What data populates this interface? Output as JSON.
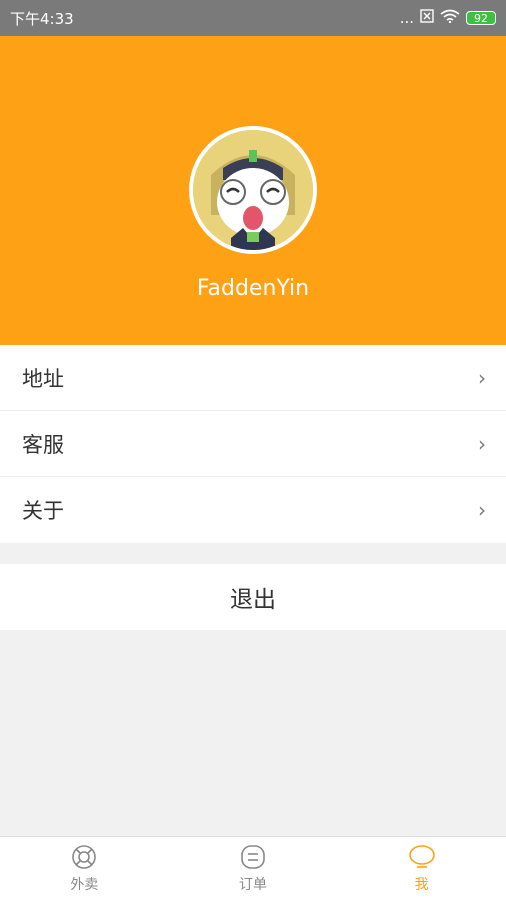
{
  "status_bar": {
    "time": "下午4:33",
    "signal_dots": "...",
    "battery": "92"
  },
  "profile": {
    "username": "FaddenYin"
  },
  "menu": {
    "items": [
      {
        "label": "地址",
        "icon": "chevron-right-icon"
      },
      {
        "label": "客服",
        "icon": "chevron-right-icon"
      },
      {
        "label": "关于",
        "icon": "chevron-right-icon"
      }
    ],
    "chevron": "›"
  },
  "logout_label": "退出",
  "tabbar": {
    "tabs": [
      {
        "label": "外卖",
        "icon": "takeout-icon",
        "active": false
      },
      {
        "label": "订单",
        "icon": "order-icon",
        "active": false
      },
      {
        "label": "我",
        "icon": "me-icon",
        "active": true
      }
    ]
  },
  "colors": {
    "accent": "#ffa114",
    "statusbar": "#7a7a7a",
    "background": "#f1f1f1"
  }
}
